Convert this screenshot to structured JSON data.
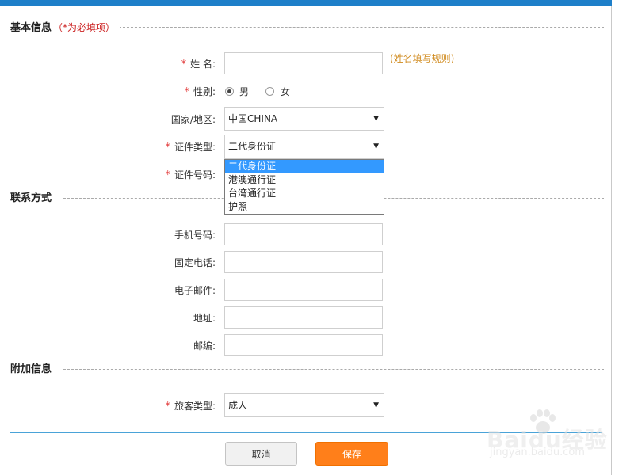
{
  "sections": {
    "basic": {
      "title": "基本信息",
      "hint": "（*为必填项）"
    },
    "contact": {
      "title": "联系方式"
    },
    "extra": {
      "title": "附加信息"
    }
  },
  "required_mark": "*",
  "basic_info": {
    "name_label": "姓 名:",
    "name_value": "",
    "name_rule_link": "(姓名填写规则)",
    "gender_label": "性别:",
    "gender_options": [
      "男",
      "女"
    ],
    "gender_selected": "男",
    "country_label": "国家/地区:",
    "country_value": "中国CHINA",
    "id_type_label": "证件类型:",
    "id_type_value": "二代身份证",
    "id_type_options": [
      "二代身份证",
      "港澳通行证",
      "台湾通行证",
      "护照"
    ],
    "id_number_label": "证件号码:"
  },
  "contact_info": {
    "mobile_label": "手机号码:",
    "phone_label": "固定电话:",
    "email_label": "电子邮件:",
    "address_label": "地址:",
    "zip_label": "邮编:"
  },
  "extra_info": {
    "passenger_type_label": "旅客类型:",
    "passenger_type_value": "成人"
  },
  "buttons": {
    "cancel": "取消",
    "save": "保存"
  },
  "watermark": {
    "text": "Baidu经验",
    "url": "jingyan.baidu.com"
  },
  "colors": {
    "accent_blue": "#1e7fc9",
    "save_orange": "#ff7f1a",
    "required_red": "#e23b3b",
    "rule_link_orange": "#d08a1d",
    "option_highlight": "#3399ff"
  }
}
